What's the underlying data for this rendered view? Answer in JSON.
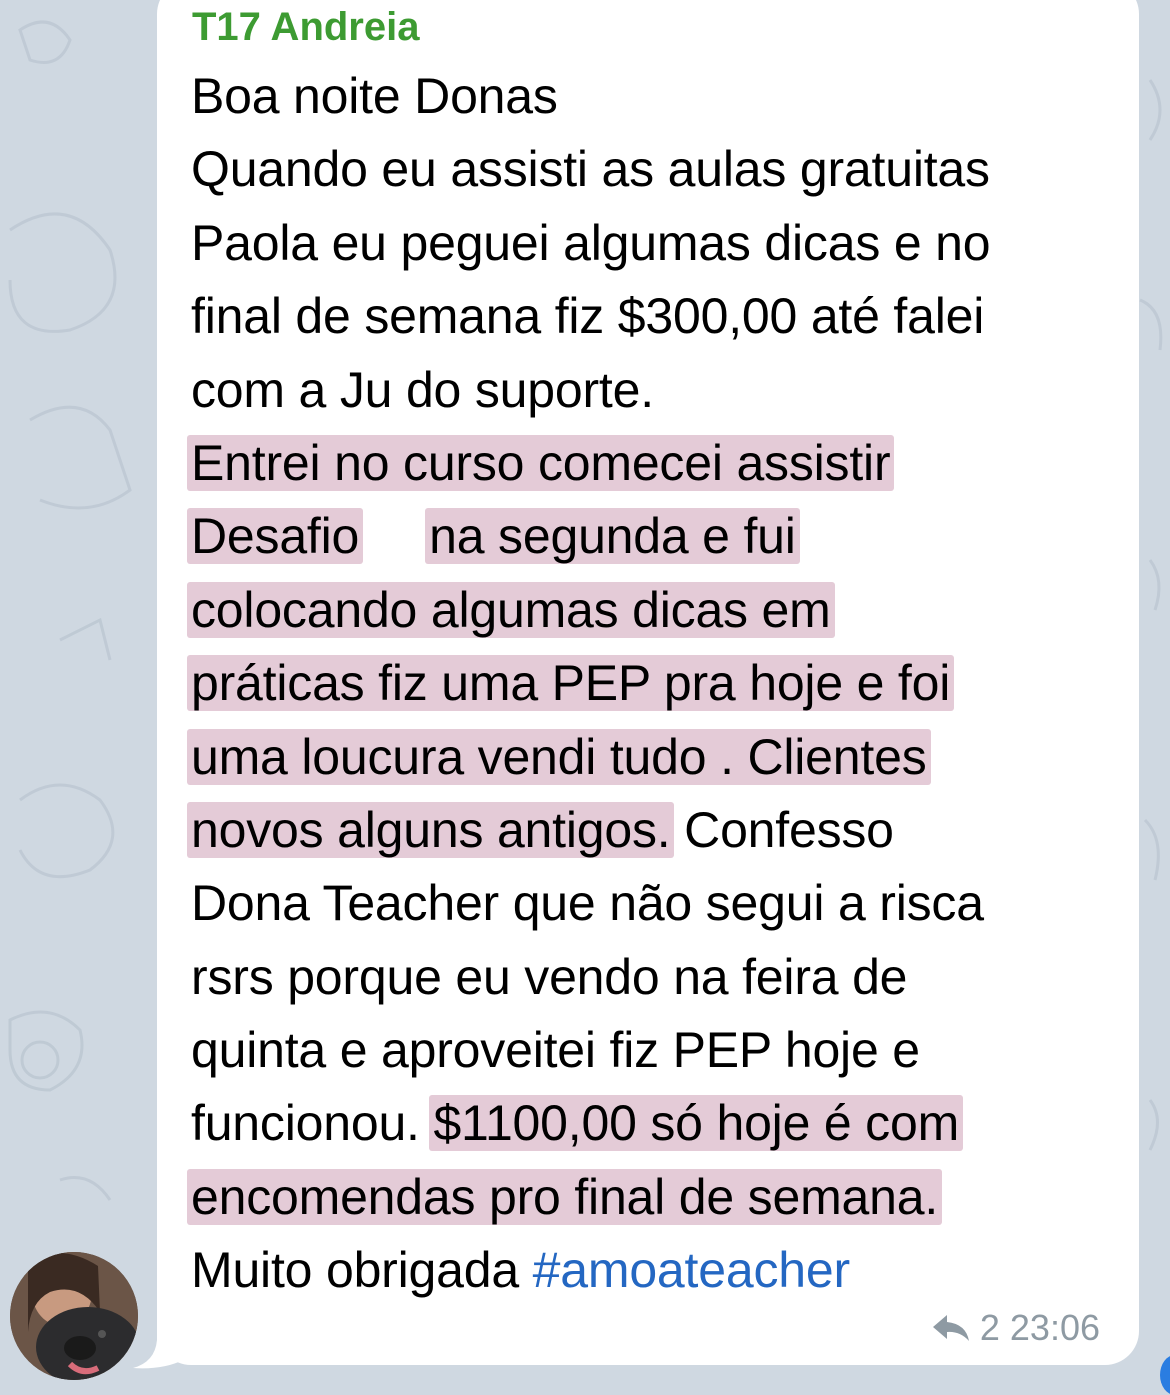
{
  "message": {
    "sender": "T17 Andreia",
    "lines": [
      "Boa noite Donas",
      "Quando eu assisti as aulas gratuitas",
      "Paola eu peguei algumas dicas e no",
      "final de semana fiz $300,00 até falei",
      "com a Ju do suporte."
    ],
    "highlight_lines": [
      "Entrei no curso comecei assistir",
      "Desafio",
      "na segunda e fui",
      "colocando algumas dicas em",
      "práticas fiz uma PEP pra hoje e foi",
      "uma loucura vendi tudo . Clientes",
      "novos alguns antigos."
    ],
    "after_highlight": " Confesso",
    "middle_lines": [
      "Dona Teacher que não segui a risca",
      "rsrs porque eu vendo na feira de",
      "quinta e aproveitei fiz PEP hoje e"
    ],
    "funcionou_prefix": "funcionou. ",
    "highlight_end": "$1100,00 só hoje é com",
    "highlight_end_line2": "encomendas pro final de semana.",
    "closing_text": "Muito obrigada ",
    "hashtag": "#amoateacher",
    "reply_count": "2",
    "time": "23:06"
  },
  "icons": {
    "reply": "reply-arrow-icon",
    "avatar": "user-avatar"
  },
  "colors": {
    "sender": "#3d9b32",
    "hashtag": "#2467c2",
    "highlight": "#d8b2c4",
    "bubble": "#ffffff",
    "wallpaper": "#cfd8e1",
    "meta": "#8e9aa3"
  }
}
